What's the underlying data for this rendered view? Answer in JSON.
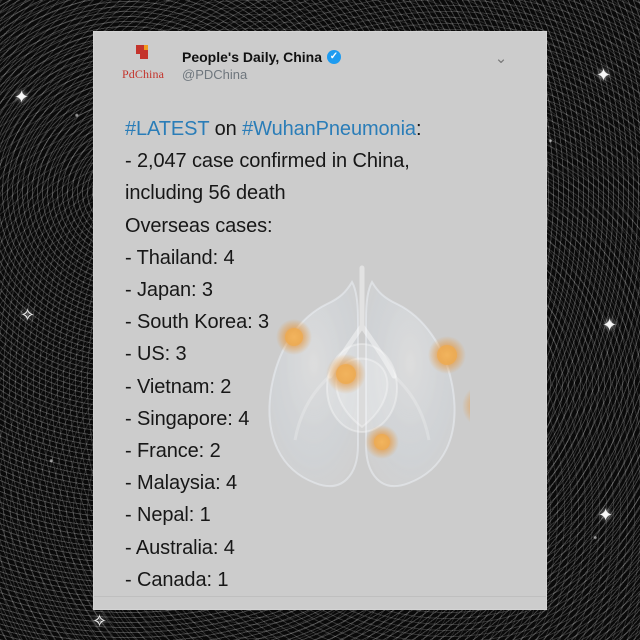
{
  "tweet": {
    "display_name": "People's Daily, China",
    "handle": "@PDChina",
    "logo_text": "PdChina",
    "more_icon": "chevron-down-icon",
    "verified_icon": "verified-badge-icon",
    "body": {
      "line1_hashtag1": "#LATEST",
      "line1_text": " on ",
      "line1_hashtag2": "#WuhanPneumonia",
      "line1_suffix": ":",
      "lines": [
        "- 2,047 case confirmed in China,",
        "including 56 death",
        "Overseas cases:",
        "- Thailand: 4",
        "- Japan: 3",
        "- South Korea: 3",
        "- US: 3",
        "- Vietnam: 2",
        "- Singapore: 4",
        "- France: 2",
        "- Malaysia: 4",
        "- Nepal: 1",
        "- Australia: 4",
        "- Canada: 1"
      ]
    }
  },
  "colors": {
    "background": "#0a0a0a",
    "card": "#cccccc",
    "hashtag": "#2a7db8",
    "logo_red": "#c4332b",
    "verified": "#1d9bf0"
  }
}
